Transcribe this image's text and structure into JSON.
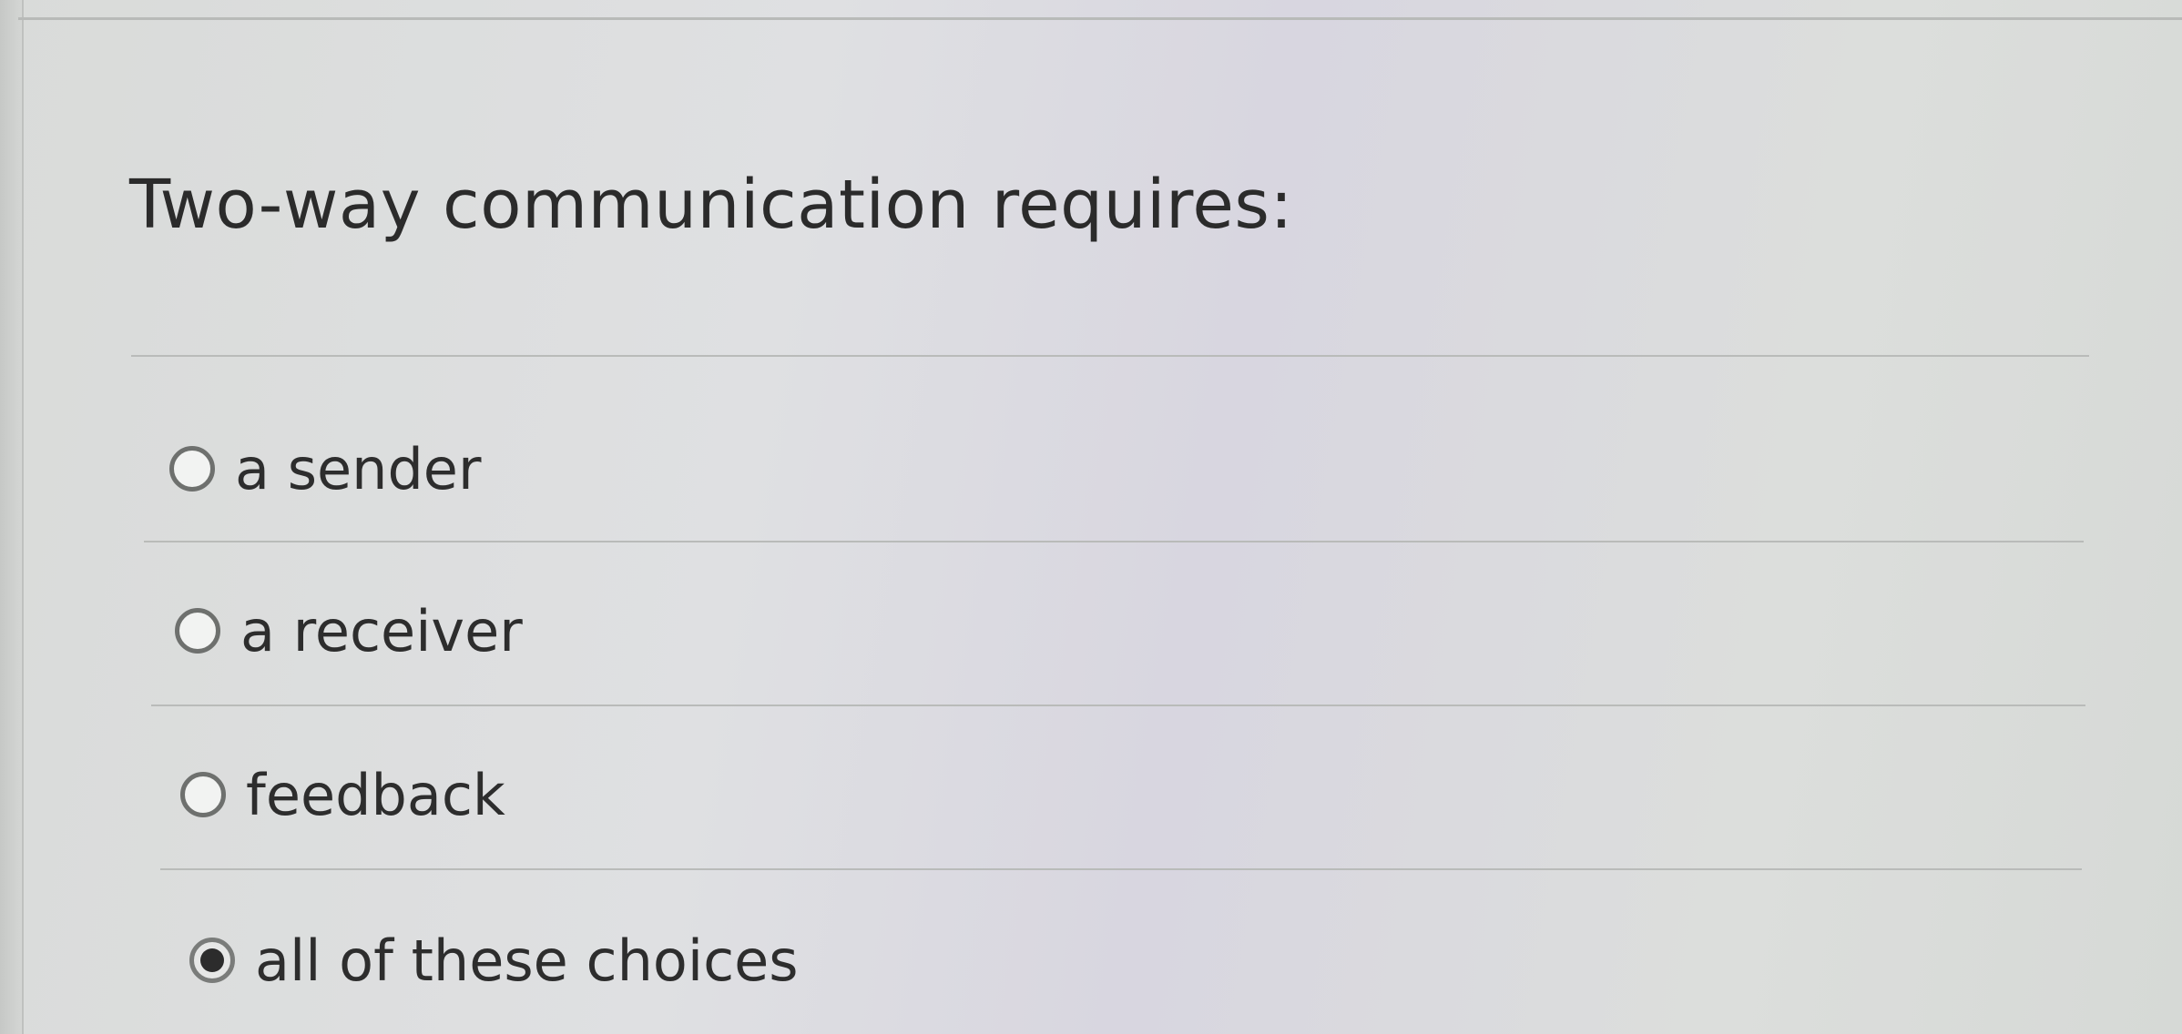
{
  "question": {
    "text": "Two-way communication requires:"
  },
  "options": [
    {
      "label": "a sender",
      "selected": false
    },
    {
      "label": "a receiver",
      "selected": false
    },
    {
      "label": "feedback",
      "selected": false
    },
    {
      "label": "all of these choices",
      "selected": true
    }
  ],
  "colors": {
    "background": "#dcdedd",
    "text": "#2b2b2b",
    "divider": "#b9bbb9",
    "radio_border": "#6e706e",
    "radio_dot": "#2c2c2c"
  }
}
